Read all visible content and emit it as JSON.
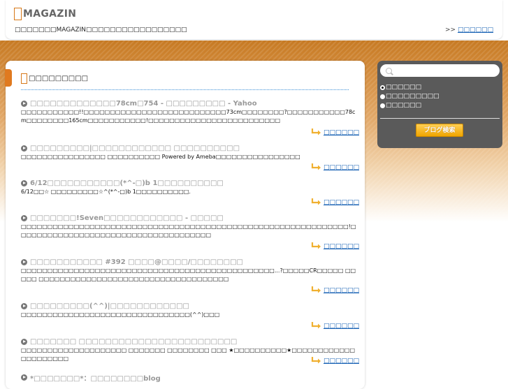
{
  "header": {
    "site_title": "MAGAZIN",
    "tagline": "□□□□□□□MAGAZIN□□□□□□□□□□□□□□□□□",
    "more_prefix": ">>",
    "more_link": "□□□□□□"
  },
  "main": {
    "section_title": "□□□□□□□□□",
    "entries": [
      {
        "title": "□□□□□□□□□□□□□78cm□754 - □□□□□□□□□ - Yahoo",
        "body": "□□□□□□□□□□□!!□□□□□□□□□□□□□□□□□□□□□□□□□□□73cm□□□□□□□□?□□□□□□□□□□□78cm□□□□□□□□165cm□□□□□□□□□□□!□□□□□□□□□□□□□□□□□□□□□□□□□",
        "link": "□□□□□□"
      },
      {
        "title": "□□□□□□□□□|□□□□□□□□□□□□ □□□□□□□□□□",
        "body": "□□□□□□□□□□□□□□□□ □□□□□□□□□□ Powered by Ameba□□□□□□□□□□□□□□□□",
        "link": "□□□□□□"
      },
      {
        "title": "6/12□□□□□□□□□□□(*^-□)b 1□□□□□□□□□□",
        "body": "6/12□□☆ □□□□□□□□□☆^(*^-□)b 1□□□□□□□□□□.",
        "link": "□□□□□□"
      },
      {
        "title": "□□□□□□□!Seven□□□□□□□□□□□□ - □□□□□",
        "body": "□□□□□□□□□□□□□□□□□□□□□□□□□□□□□□□□□□□□□□□□□□□□□□□□□□□□□□□□□□□□□□!□□□□□□□□□□□□□□□□□□□□□□□□□□□□□□□□□□□□□",
        "link": "□□□□□□"
      },
      {
        "title": "□□□□□□□□□□□ #392 □□□□@□□□□/□□□□□□□□",
        "body": "□□□□□□□□□□□□□□□□□□□□□□□□□□□□□□□□□□□□□□□□□□□□□□□□...?□□□□□CR□□□□□ □□□□□ □□□□□□□□□□□□□□□□□□□□□□□□□□□□□□□□□□□□",
        "link": "□□□□□□"
      },
      {
        "title": "□□□□□□□□□(^^)|□□□□□□□□□□□□",
        "body": "□□□□□□□□□□□□□□□□□□□□□□□□□□□□□□□□(^^)□□□",
        "link": "□□□□□□"
      },
      {
        "title": "□□□□□□□ □□□□□□□□□□□□□□□□□□□□□□□□",
        "body": "□□□□□□□□□□□□□□□□□□□□ □□□□□□□ □□□□□□□□ □□□ ★□□□□□□□□□□★□□□□□□□□□□□□□□□□□□□□□",
        "link": "□□□□□□"
      },
      {
        "title": "*□□□□□□□*：□□□□□□□□blog",
        "body": "",
        "link": ""
      }
    ]
  },
  "sidebar": {
    "search_placeholder": "",
    "options": [
      "□□□□□□",
      "□□□□□□□□□",
      "□□□□□□"
    ],
    "search_button": "ブログ検索"
  }
}
